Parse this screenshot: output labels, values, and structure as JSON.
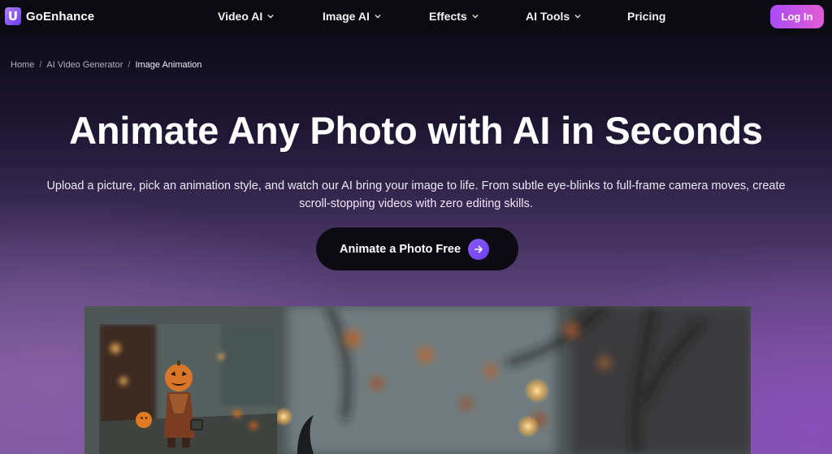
{
  "brand": {
    "name": "GoEnhance",
    "logo_glyph": "U"
  },
  "nav": {
    "items": [
      {
        "label": "Video AI",
        "has_dropdown": true
      },
      {
        "label": "Image AI",
        "has_dropdown": true
      },
      {
        "label": "Effects",
        "has_dropdown": true
      },
      {
        "label": "AI Tools",
        "has_dropdown": true
      },
      {
        "label": "Pricing",
        "has_dropdown": false
      }
    ],
    "login_label": "Log In"
  },
  "breadcrumb": {
    "items": [
      "Home",
      "AI Video Generator",
      "Image Animation"
    ],
    "separator": "/"
  },
  "hero": {
    "title": "Animate Any Photo with AI in Seconds",
    "subtitle": "Upload a picture, pick an animation style, and watch our AI bring your image to life. From subtle eye-blinks to full-frame camera moves, create scroll-stopping videos with zero editing skills.",
    "cta_label": "Animate a Photo Free"
  },
  "icons": {
    "chevron": "chevron-down-icon",
    "cta_arrow": "arrow-right-icon"
  },
  "colors": {
    "login_gradient_start": "#a84cf5",
    "login_gradient_end": "#e25cd4",
    "cta_arrow": "#7c4df3",
    "nav_background": "#0b0a10"
  }
}
